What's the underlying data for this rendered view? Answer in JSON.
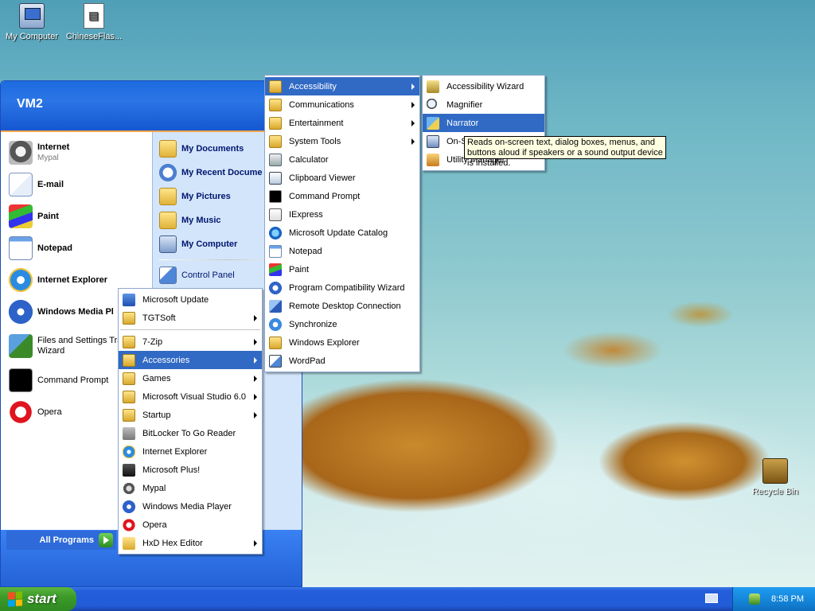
{
  "desktop": {
    "icons": [
      {
        "label": "My Computer"
      },
      {
        "label": "ChineseFlas..."
      },
      {
        "label": "Recycle Bin"
      }
    ]
  },
  "start_menu": {
    "user": "VM2",
    "pinned": [
      {
        "label": "Internet",
        "sub": "Mypal"
      },
      {
        "label": "E-mail"
      }
    ],
    "recent": [
      {
        "label": "Paint"
      },
      {
        "label": "Notepad"
      },
      {
        "label": "Internet Explorer"
      },
      {
        "label": "Windows Media Pl"
      },
      {
        "label": "Files and Settings Tra\nWizard"
      },
      {
        "label": "Command Prompt"
      },
      {
        "label": "Opera"
      }
    ],
    "right": [
      {
        "label": "My Documents"
      },
      {
        "label": "My Recent Docume"
      },
      {
        "label": "My Pictures"
      },
      {
        "label": "My Music"
      },
      {
        "label": "My Computer"
      },
      {
        "label": "Control Panel"
      }
    ],
    "all_programs": "All Programs"
  },
  "programs_menu": [
    {
      "label": "Microsoft Update",
      "arrow": false
    },
    {
      "label": "TGTSoft",
      "arrow": true
    },
    {
      "label": "7-Zip",
      "arrow": true
    },
    {
      "label": "Accessories",
      "arrow": true
    },
    {
      "label": "Games",
      "arrow": true
    },
    {
      "label": "Microsoft Visual Studio 6.0",
      "arrow": true
    },
    {
      "label": "Startup",
      "arrow": true
    },
    {
      "label": "BitLocker To Go Reader",
      "arrow": false
    },
    {
      "label": "Internet Explorer",
      "arrow": false
    },
    {
      "label": "Microsoft Plus!",
      "arrow": false
    },
    {
      "label": "Mypal",
      "arrow": false
    },
    {
      "label": "Windows Media Player",
      "arrow": false
    },
    {
      "label": "Opera",
      "arrow": false
    },
    {
      "label": "HxD Hex Editor",
      "arrow": true
    }
  ],
  "accessories_menu": [
    {
      "label": "Accessibility",
      "arrow": true
    },
    {
      "label": "Communications",
      "arrow": true
    },
    {
      "label": "Entertainment",
      "arrow": true
    },
    {
      "label": "System Tools",
      "arrow": true
    },
    {
      "label": "Calculator",
      "arrow": false
    },
    {
      "label": "Clipboard Viewer",
      "arrow": false
    },
    {
      "label": "Command Prompt",
      "arrow": false
    },
    {
      "label": "IExpress",
      "arrow": false
    },
    {
      "label": "Microsoft Update Catalog",
      "arrow": false
    },
    {
      "label": "Notepad",
      "arrow": false
    },
    {
      "label": "Paint",
      "arrow": false
    },
    {
      "label": "Program Compatibility Wizard",
      "arrow": false
    },
    {
      "label": "Remote Desktop Connection",
      "arrow": false
    },
    {
      "label": "Synchronize",
      "arrow": false
    },
    {
      "label": "Windows Explorer",
      "arrow": false
    },
    {
      "label": "WordPad",
      "arrow": false
    }
  ],
  "accessibility_menu": [
    {
      "label": "Accessibility Wizard"
    },
    {
      "label": "Magnifier"
    },
    {
      "label": "Narrator"
    },
    {
      "label": "On-Screen Keyboard"
    },
    {
      "label": "Utility Manager"
    }
  ],
  "tooltip": "Reads on-screen text, dialog boxes, menus, and buttons aloud if speakers or a sound output device is installed.",
  "taskbar": {
    "start_label": "start",
    "clock": "8:58 PM"
  },
  "colors": {
    "highlight": "#316ac5",
    "taskbar": "#245edb",
    "start_green": "#3c9a2a"
  }
}
